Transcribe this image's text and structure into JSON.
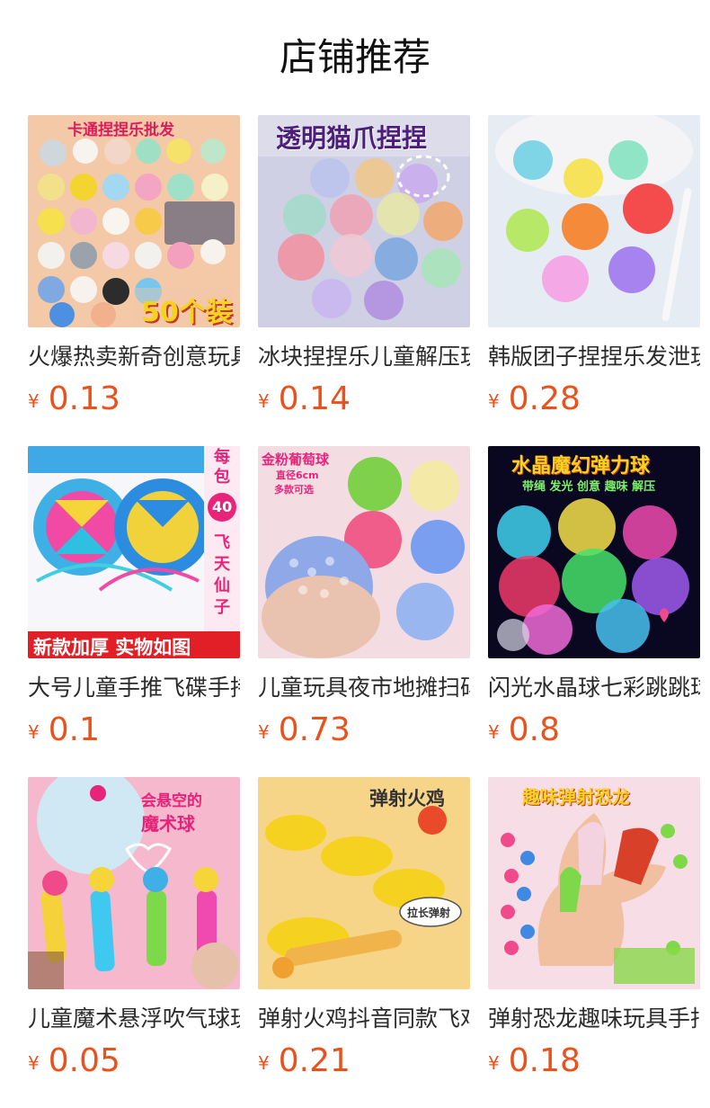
{
  "header": {
    "title": "店铺推荐"
  },
  "currency_symbol": "¥",
  "products": [
    {
      "name": "火爆热卖新奇创意玩具",
      "price": "0.13",
      "image_text": [
        "卡通捏捏乐批发",
        "50个装"
      ]
    },
    {
      "name": "冰块捏捏乐儿童解压玩具",
      "price": "0.14",
      "image_text": [
        "透明猫爪捏捏"
      ]
    },
    {
      "name": "韩版团子捏捏乐发泄玩具",
      "price": "0.28",
      "image_text": []
    },
    {
      "name": "大号儿童手推飞碟手持玩具",
      "price": "0.1",
      "image_text": [
        "每包",
        "40",
        "飞天仙子",
        "新款加厚 实物如图"
      ]
    },
    {
      "name": "儿童玩具夜市地摊扫码玩具",
      "price": "0.73",
      "image_text": [
        "金粉葡萄球",
        "直径6cm",
        "多款可选"
      ]
    },
    {
      "name": "闪光水晶球七彩跳跳球",
      "price": "0.8",
      "image_text": [
        "水晶魔幻弹力球",
        "带绳 发光 创意 趣味 解压"
      ]
    },
    {
      "name": "儿童魔术悬浮吹气球玩具",
      "price": "0.05",
      "image_text": [
        "会悬空的",
        "魔术球"
      ]
    },
    {
      "name": "弹射火鸡抖音同款飞鸡",
      "price": "0.21",
      "image_text": [
        "弹射火鸡",
        "拉长弹射"
      ]
    },
    {
      "name": "弹射恐龙趣味玩具手指",
      "price": "0.18",
      "image_text": [
        "趣味弹射恐龙"
      ]
    }
  ],
  "colors": {
    "price": "#e8521d",
    "title": "#111111",
    "name": "#2b2b2b"
  }
}
